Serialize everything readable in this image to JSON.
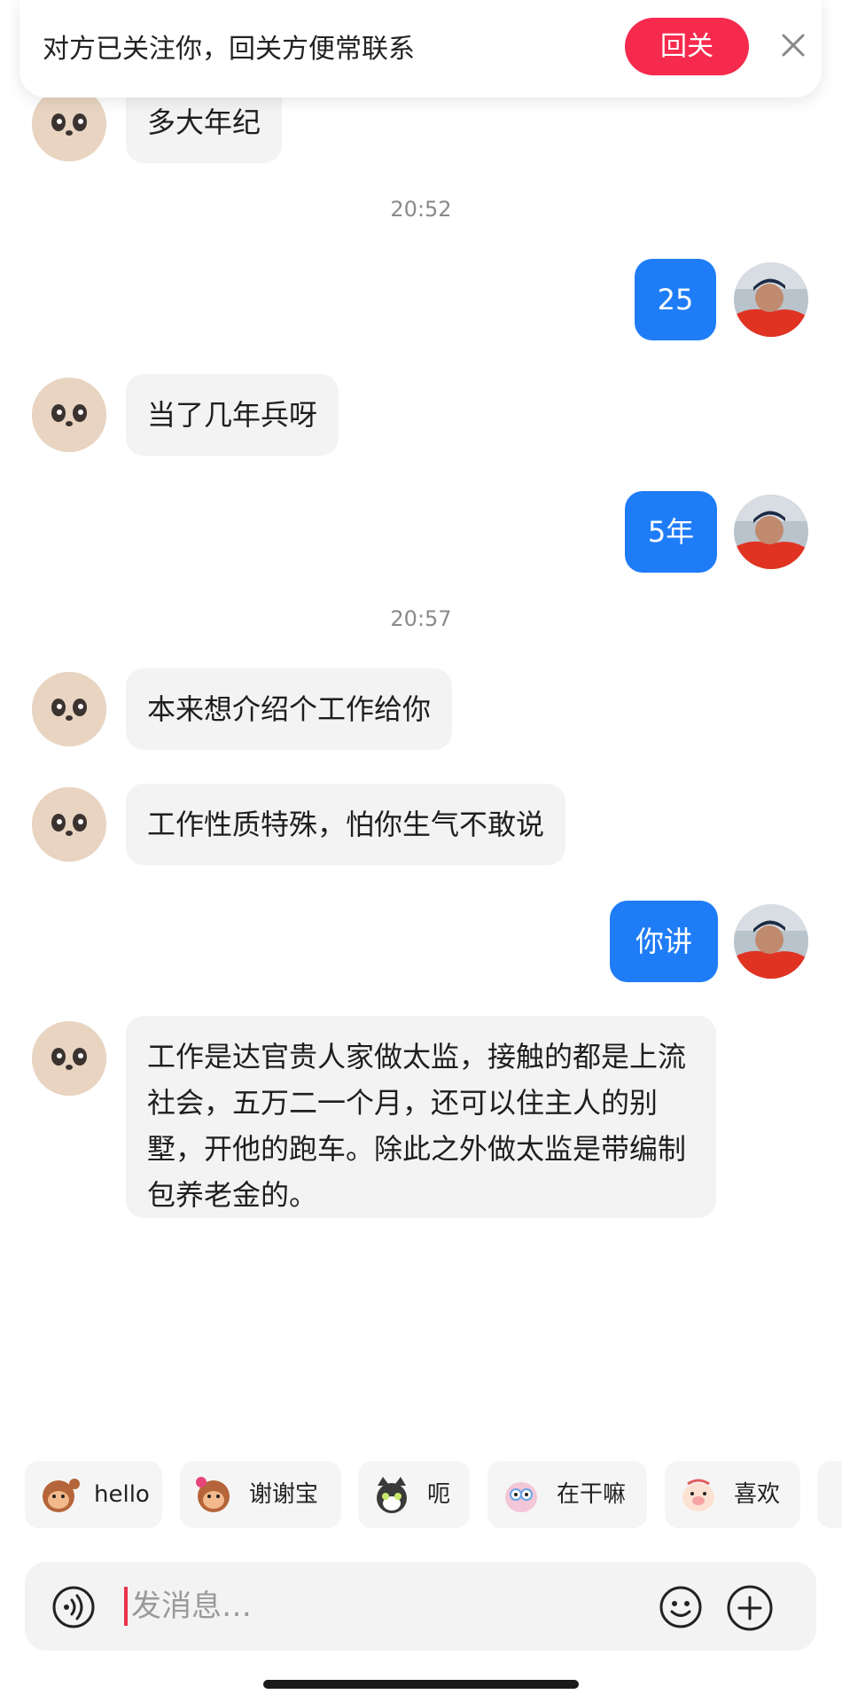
{
  "banner": {
    "text": "对方已关注你，回关方便常联系",
    "follow_label": "回关",
    "follow_color": "#f62a4d"
  },
  "messages": {
    "m1": "多大年纪",
    "time1": "20:52",
    "m2": "25",
    "m3": "当了几年兵呀",
    "m4": "5年",
    "time2": "20:57",
    "m5": "本来想介绍个工作给你",
    "m6": "工作性质特殊，怕你生气不敢说",
    "m7": "你讲",
    "m8": "工作是达官贵人家做太监，接触的都是上流社会，五万二一个月，还可以住主人的别墅，开他的跑车。除此之外做太监是带编制包养老金的。"
  },
  "quick_replies": [
    {
      "label": "hello",
      "icon": "monkey-wave-icon"
    },
    {
      "label": "谢谢宝",
      "icon": "monkey-flower-icon"
    },
    {
      "label": "呃",
      "icon": "cat-icon"
    },
    {
      "label": "在干嘛",
      "icon": "blob-icon"
    },
    {
      "label": "喜欢",
      "icon": "pig-icon"
    }
  ],
  "input": {
    "placeholder": "发消息…"
  },
  "colors": {
    "outgoing_bubble": "#1f7cf7",
    "incoming_bubble": "#f3f3f3"
  }
}
